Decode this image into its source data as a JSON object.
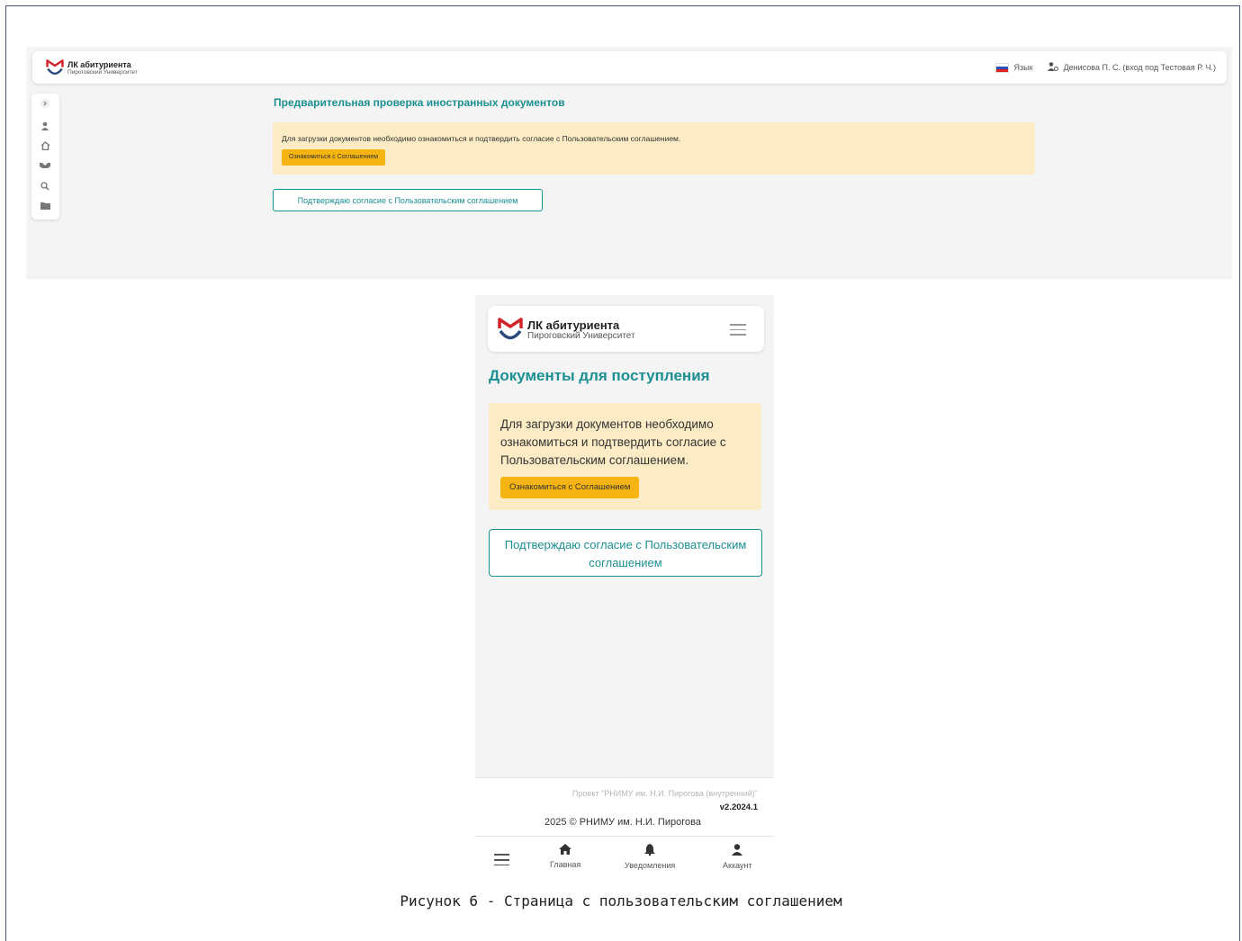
{
  "brand": {
    "title": "ЛК абитуриента",
    "subtitle": "Пироговский Университет",
    "colors": {
      "teal": "#1b8f91",
      "red": "#d2232a",
      "navy": "#2a4a7e",
      "alert_bg": "#fcecc5",
      "button_yellow": "#f5b412"
    }
  },
  "desktop": {
    "header": {
      "language_label": "Язык",
      "user_label": "Денисова П. С. (вход под Тестовая Р. Ч.)"
    },
    "sidebar_icons": [
      "chevron-right-icon",
      "user-icon",
      "home-icon",
      "handshake-icon",
      "search-icon",
      "folder-icon"
    ],
    "page_title": "Предварительная проверка иностранных документов",
    "alert": {
      "text": "Для загрузки документов необходимо ознакомиться и подтвердить согласие с Пользовательским соглашением.",
      "button": "Ознакомиться с Соглашением"
    },
    "confirm_button": "Подтверждаю согласие с Пользовательским соглашением"
  },
  "mobile": {
    "page_title": "Документы для поступления",
    "alert": {
      "text": "Для загрузки документов необходимо ознакомиться и подтвердить согласие с Пользовательским соглашением.",
      "button": "Ознакомиться с Соглашением"
    },
    "confirm_button": "Подтверждаю согласие с Пользовательским соглашением",
    "footer": {
      "project": "Проект \"РНИМУ им. Н.И. Пирогова (внутренний)\"",
      "version": "v2.2024.1",
      "copyright": "2025 © РНИМУ им. Н.И. Пирогова"
    },
    "nav": {
      "home": "Главная",
      "notifications": "Уведомления",
      "account": "Аккаунт"
    }
  },
  "caption": "Рисунок 6 - Страница с пользовательским соглашением"
}
